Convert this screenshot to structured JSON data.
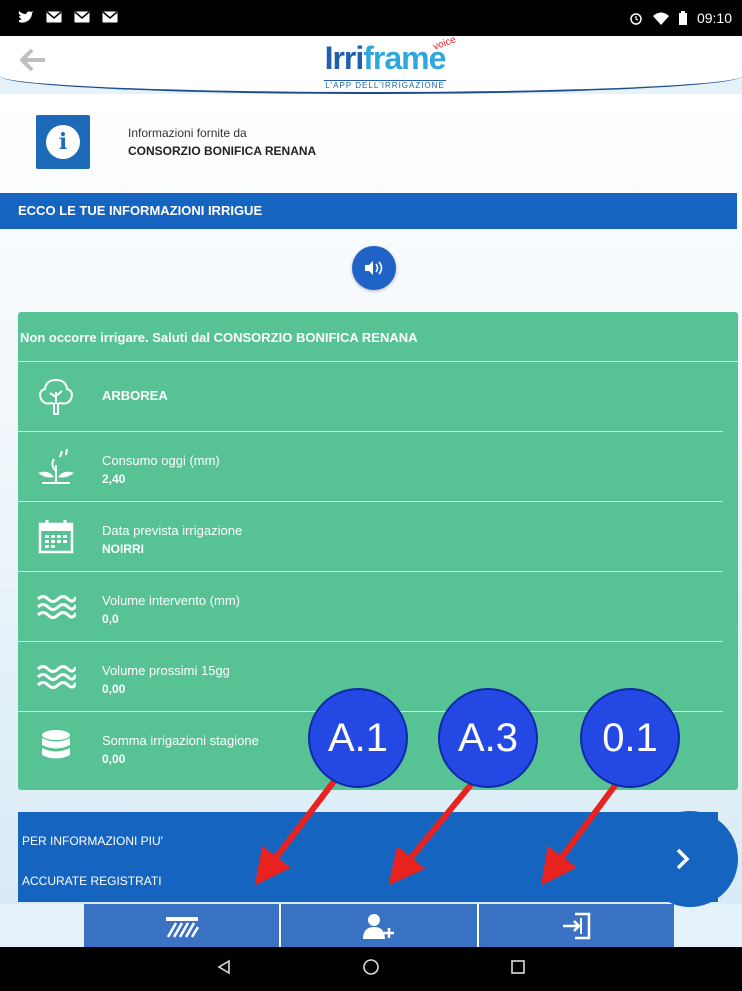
{
  "status_bar": {
    "notifications": [
      "twitter-icon",
      "mail-icon",
      "mail-icon",
      "mail-icon"
    ],
    "time": "09:10"
  },
  "header": {
    "logo_name_part1": "Irri",
    "logo_name_part2": "frame",
    "logo_tag": "voice",
    "logo_tagline": "L'APP DELL'IRRIGAZIONE"
  },
  "info": {
    "provided_by": "Informazioni fornite da",
    "organization": "CONSORZIO BONIFICA RENANA"
  },
  "section_title": "ECCO LE TUE INFORMAZIONI IRRIGUE",
  "card": {
    "message": "Non occorre irrigare. Saluti dal CONSORZIO BONIFICA RENANA",
    "crop": "ARBOREA",
    "rows": [
      {
        "label": "Consumo oggi (mm)",
        "value": "2,40",
        "icon": "sprout-icon"
      },
      {
        "label": "Data prevista irrigazione",
        "value": "NOIRRI",
        "icon": "calendar-icon"
      },
      {
        "label": "Volume intervento (mm)",
        "value": "0,0",
        "icon": "water-waves-icon"
      },
      {
        "label": "Volume prossimi 15gg",
        "value": "0,00",
        "icon": "water-waves-icon"
      },
      {
        "label": "Somma irrigazioni stagione",
        "value": "0,00",
        "icon": "database-icon"
      }
    ]
  },
  "register_bar": {
    "line1": "PER INFORMAZIONI PIU'",
    "line2": "ACCURATE REGISTRATI"
  },
  "annotations": [
    "A.1",
    "A.3",
    "0.1"
  ],
  "colors": {
    "primary_blue": "#1565c0",
    "card_green": "#57c395",
    "annotation_blue": "#2448e3",
    "arrow_red": "#e8231f"
  }
}
